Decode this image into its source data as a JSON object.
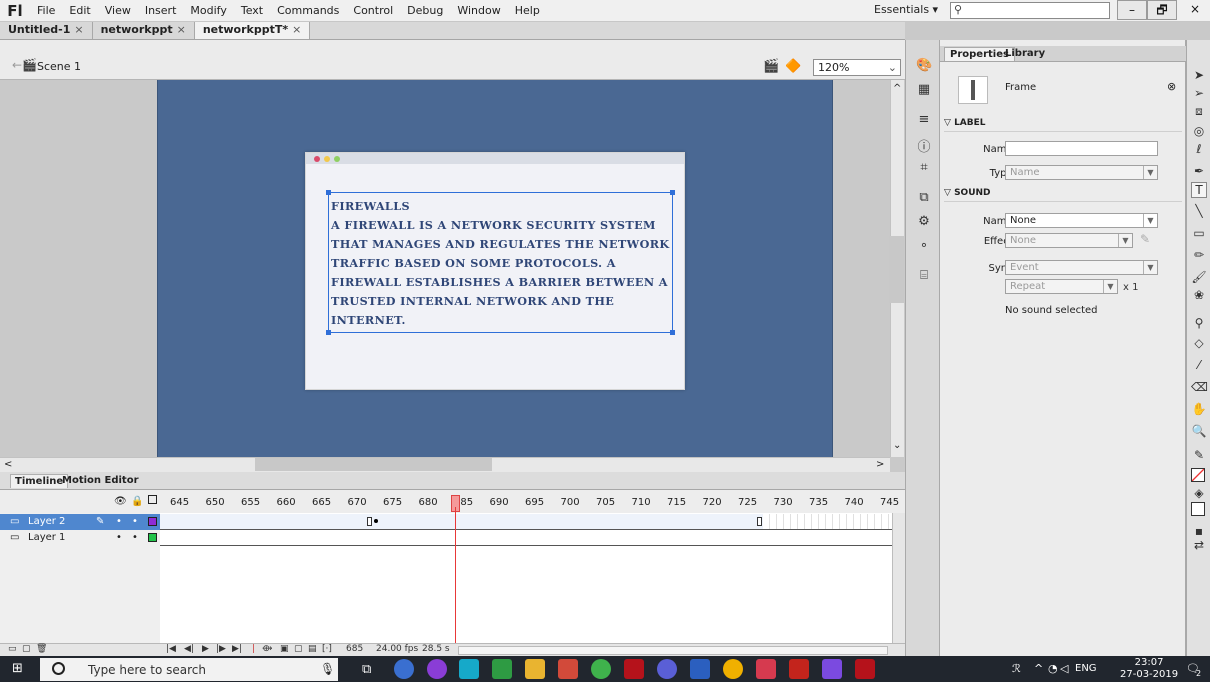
{
  "app": {
    "logo": "Fl",
    "workspace": "Essentials ▾"
  },
  "menu": [
    "File",
    "Edit",
    "View",
    "Insert",
    "Modify",
    "Text",
    "Commands",
    "Control",
    "Debug",
    "Window",
    "Help"
  ],
  "window_controls": {
    "minimize": "–",
    "restore": "🗗",
    "close": "×"
  },
  "doc_tabs": [
    {
      "label": "Untitled-1",
      "close": "×"
    },
    {
      "label": "networkppt",
      "close": "×"
    },
    {
      "label": "networkpptT*",
      "close": "×"
    }
  ],
  "editbar": {
    "scene": "Scene 1",
    "zoom": "120%"
  },
  "stage": {
    "text_lines": [
      "Firewalls",
      "A firewall is a network security system",
      "that manages and regulates the network",
      "traffic based on some protocols. A",
      "firewall establishes a barrier between a",
      "trusted internal network and the",
      "internet."
    ]
  },
  "timeline": {
    "tabs": [
      "Timeline",
      "Motion Editor"
    ],
    "frame_numbers": [
      "645",
      "650",
      "655",
      "660",
      "665",
      "670",
      "675",
      "680",
      "685",
      "690",
      "695",
      "700",
      "705",
      "710",
      "715",
      "720",
      "725",
      "730",
      "735",
      "740",
      "745"
    ],
    "layers": [
      {
        "name": "Layer 2",
        "color": "#8f2bd6"
      },
      {
        "name": "Layer 1",
        "color": "#22c34a"
      }
    ],
    "current_frame": "685",
    "fps": "24.00 fps",
    "time": "28.5 s"
  },
  "properties": {
    "tabs": [
      "Properties",
      "Library"
    ],
    "object_type": "Frame",
    "label_section": "LABEL",
    "name_label": "Name:",
    "type_label": "Type:",
    "type_value": "Name",
    "sound_section": "SOUND",
    "sound_name_label": "Name:",
    "sound_name_value": "None",
    "effect_label": "Effect:",
    "effect_value": "None",
    "sync_label": "Sync:",
    "sync_value": "Event",
    "repeat_value": "Repeat",
    "repeat_count": "x 1",
    "no_sound": "No sound selected"
  },
  "taskbar": {
    "search_placeholder": "Type here to search",
    "lang": "ENG",
    "time": "23:07",
    "date": "27-03-2019",
    "notifications": "2"
  },
  "colors": {
    "stage": "#4a6893",
    "text": "#2f4677",
    "selection": "#2f6fd8",
    "playhead": "#e83838"
  }
}
